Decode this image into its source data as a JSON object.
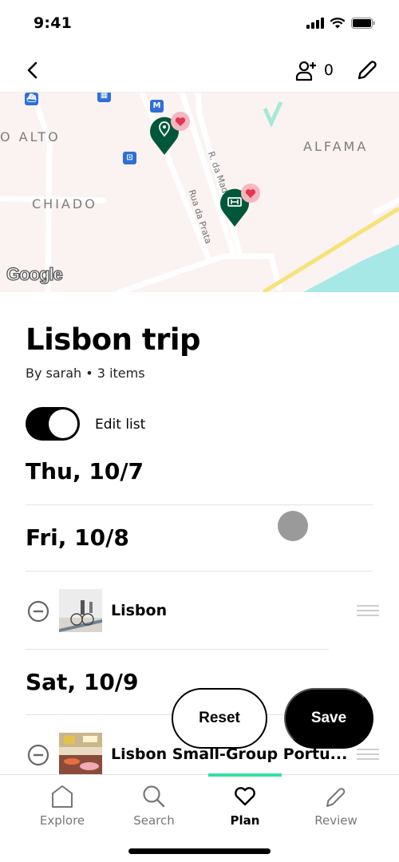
{
  "status_bar": {
    "time": "9:41"
  },
  "nav": {
    "invite_count": "0"
  },
  "map": {
    "labels": {
      "bairro_alto": "O ALTO",
      "alfama": "ALFAMA",
      "chiado": "CHIADO"
    },
    "streets": {
      "rua_da_prata": "Rua da Prata",
      "r_da_madalena": "R. da Mad"
    },
    "metro_label": "M",
    "attribution": "Google",
    "pins": [
      {
        "type": "location",
        "saved": true
      },
      {
        "type": "ticket",
        "saved": true
      }
    ]
  },
  "trip": {
    "title": "Lisbon trip",
    "subtitle": "By sarah • 3 items",
    "edit_toggle": {
      "label": "Edit list",
      "on": true
    }
  },
  "days": [
    {
      "label": "Thu, 10/7",
      "items": []
    },
    {
      "label": "Fri, 10/8",
      "items": [
        {
          "title": "Lisbon"
        }
      ]
    },
    {
      "label": "Sat, 10/9",
      "items": [
        {
          "title": "Lisbon Small-Group Portu..."
        }
      ]
    }
  ],
  "actions": {
    "reset": "Reset",
    "save": "Save"
  },
  "tabs": [
    {
      "label": "Explore",
      "icon": "home-icon",
      "active": false
    },
    {
      "label": "Search",
      "icon": "search-icon",
      "active": false
    },
    {
      "label": "Plan",
      "icon": "heart-icon",
      "active": true
    },
    {
      "label": "Review",
      "icon": "pencil-icon",
      "active": false
    }
  ],
  "colors": {
    "accent": "#34e0a1",
    "pin_green": "#00573a",
    "heart_pink": "#f7b7c0",
    "heart_red": "#e8344f",
    "map_bg": "#fbf3f2",
    "water": "#a6e8e6",
    "highway": "#f7e27a"
  }
}
